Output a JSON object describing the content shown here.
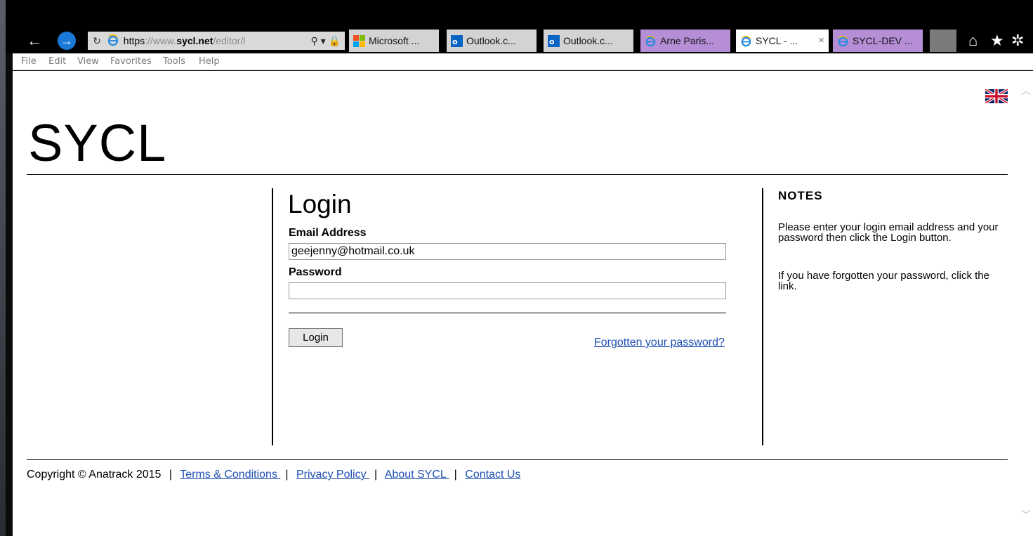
{
  "browser": {
    "address_scheme": "https",
    "address_sep": "://",
    "address_prefix": "www.",
    "address_host": "sycl.net",
    "address_path": "/editor/l",
    "tabs": [
      {
        "label": "Microsoft ...",
        "icon": "microsoft-logo-icon"
      },
      {
        "label": "Outlook.c...",
        "icon": "outlook-icon"
      },
      {
        "label": "Outlook.c...",
        "icon": "outlook-icon"
      },
      {
        "label": "Arne Paris...",
        "icon": "ie-icon"
      },
      {
        "label": "SYCL - ...",
        "icon": "ie-icon",
        "active": true
      },
      {
        "label": "SYCL-DEV ...",
        "icon": "ie-icon"
      }
    ],
    "close_glyph": "×",
    "menu": [
      "File",
      "Edit",
      "View",
      "Favorites",
      "Tools",
      "Help"
    ]
  },
  "page": {
    "logo": "SYCL",
    "login": {
      "title": "Login",
      "email_label": "Email Address",
      "email_value": "geejenny@hotmail.co.uk",
      "password_label": "Password",
      "password_value": "",
      "button": "Login",
      "forgot_link": "Forgotten your password?"
    },
    "notes": {
      "title": "NOTES",
      "paragraphs": [
        "Please enter your login email address and your password then click the Login button.",
        "If you have forgotten your password, click the link."
      ]
    },
    "footer": {
      "copyright": "Copyright © Anatrack 2015",
      "separator": "|",
      "links": [
        "Terms & Conditions ",
        "Privacy Policy ",
        "About SYCL ",
        "Contact Us"
      ]
    }
  },
  "colors": {
    "link": "#1f4fb2",
    "tab_purple": "#b58ed6",
    "ie_blue": "#1a78d6"
  }
}
